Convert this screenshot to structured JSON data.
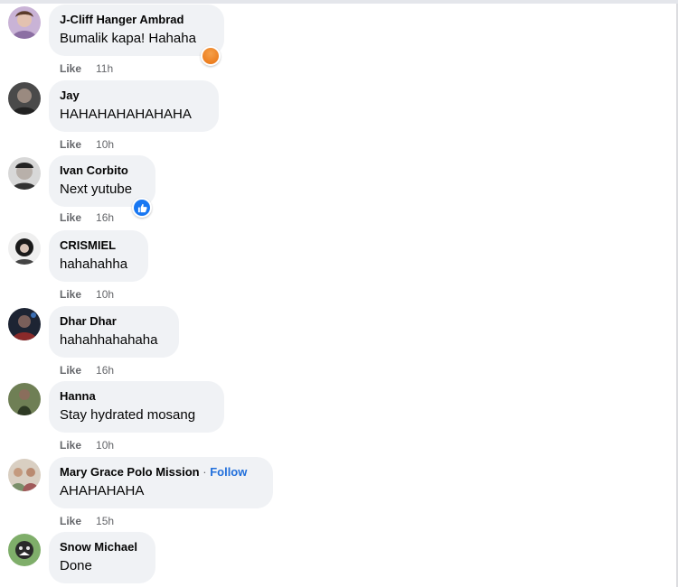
{
  "comments": [
    {
      "name": "J-Cliff Hanger Ambrad",
      "text": "Bumalik kapa! Hahaha",
      "action": "Like",
      "time": "11h",
      "reaction": "angry-reaction-icon"
    },
    {
      "name": "Jay",
      "text": "HAHAHAHAHAHAHA",
      "action": "Like",
      "time": "10h"
    },
    {
      "name": "Ivan Corbito",
      "text": "Next yutube",
      "action": "Like",
      "time": "16h",
      "reaction": "like-reaction-icon"
    },
    {
      "name": "CRISMIEL",
      "text": "hahahahha",
      "action": "Like",
      "time": "10h"
    },
    {
      "name": "Dhar Dhar",
      "text": "hahahhahahaha",
      "action": "Like",
      "time": "16h"
    },
    {
      "name": "Hanna",
      "text": "Stay hydrated mosang",
      "action": "Like",
      "time": "10h"
    },
    {
      "name": "Mary Grace Polo Mission",
      "separator": "·",
      "follow": "Follow",
      "text": "AHAHAHAHA",
      "action": "Like",
      "time": "15h"
    },
    {
      "name": "Snow Michael",
      "text": "Done"
    }
  ],
  "colors": {
    "bubble": "#f0f2f5",
    "meta_text": "#65676b",
    "follow_link": "#216fdb",
    "angry_reaction": "#e9710f",
    "like_reaction": "#1877f2"
  }
}
